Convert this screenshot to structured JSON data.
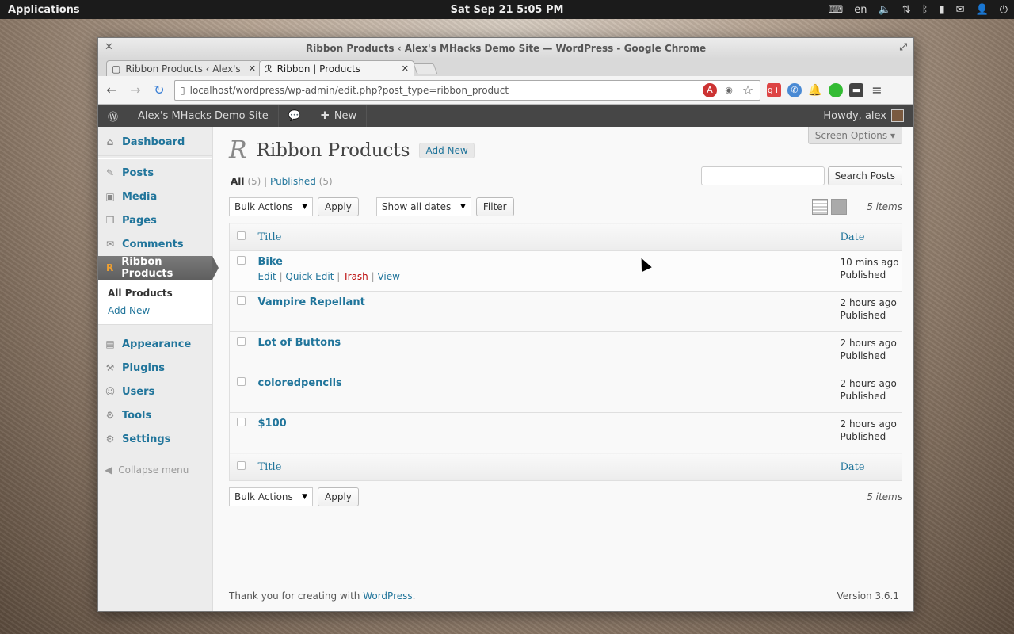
{
  "panel": {
    "apps": "Applications",
    "clock": "Sat Sep 21  5:05 PM",
    "lang": "en"
  },
  "window": {
    "title": "Ribbon Products ‹ Alex's MHacks Demo Site — WordPress - Google Chrome"
  },
  "tabs": [
    {
      "label": "Ribbon Products ‹ Alex's M",
      "close": "✕"
    },
    {
      "label": "Ribbon | Products",
      "close": "✕"
    }
  ],
  "address": {
    "url": "localhost/wordpress/wp-admin/edit.php?post_type=ribbon_product"
  },
  "adminbar": {
    "site": "Alex's MHacks Demo Site",
    "new": "New",
    "howdy": "Howdy, alex"
  },
  "menu": {
    "items_top": [
      {
        "label": "Dashboard",
        "icon": "⌂"
      },
      {
        "label": "Posts",
        "icon": "✎"
      },
      {
        "label": "Media",
        "icon": "▣"
      },
      {
        "label": "Pages",
        "icon": "❐"
      },
      {
        "label": "Comments",
        "icon": "✉"
      }
    ],
    "current": {
      "label": "Ribbon Products",
      "icon": "R"
    },
    "submenu": [
      "All Products",
      "Add New"
    ],
    "items_bottom": [
      {
        "label": "Appearance",
        "icon": "▤"
      },
      {
        "label": "Plugins",
        "icon": "⚒"
      },
      {
        "label": "Users",
        "icon": "☺"
      },
      {
        "label": "Tools",
        "icon": "⚙"
      },
      {
        "label": "Settings",
        "icon": "⚙"
      }
    ],
    "collapse": "Collapse menu"
  },
  "content": {
    "screen_options": "Screen Options ▾",
    "heading": "Ribbon Products",
    "logo": "R",
    "add_new": "Add New",
    "filters": {
      "all": "All",
      "all_count": "(5)",
      "sep": "|",
      "published": "Published",
      "published_count": "(5)"
    },
    "search_button": "Search Posts",
    "bulk_actions": "Bulk Actions",
    "apply": "Apply",
    "dates": "Show all dates",
    "filter": "Filter",
    "items_count": "5 items",
    "col_title": "Title",
    "col_date": "Date",
    "rows": [
      {
        "title": "Bike",
        "date": "10 mins ago",
        "status": "Published"
      },
      {
        "title": "Vampire Repellant",
        "date": "2 hours ago",
        "status": "Published"
      },
      {
        "title": "Lot of Buttons",
        "date": "2 hours ago",
        "status": "Published"
      },
      {
        "title": "coloredpencils",
        "date": "2 hours ago",
        "status": "Published"
      },
      {
        "title": "$100",
        "date": "2 hours ago",
        "status": "Published"
      }
    ],
    "row_actions": {
      "edit": "Edit",
      "quick_edit": "Quick Edit",
      "trash": "Trash",
      "view": "View"
    },
    "footer_text": "Thank you for creating with ",
    "footer_link": "WordPress",
    "version": "Version 3.6.1"
  }
}
